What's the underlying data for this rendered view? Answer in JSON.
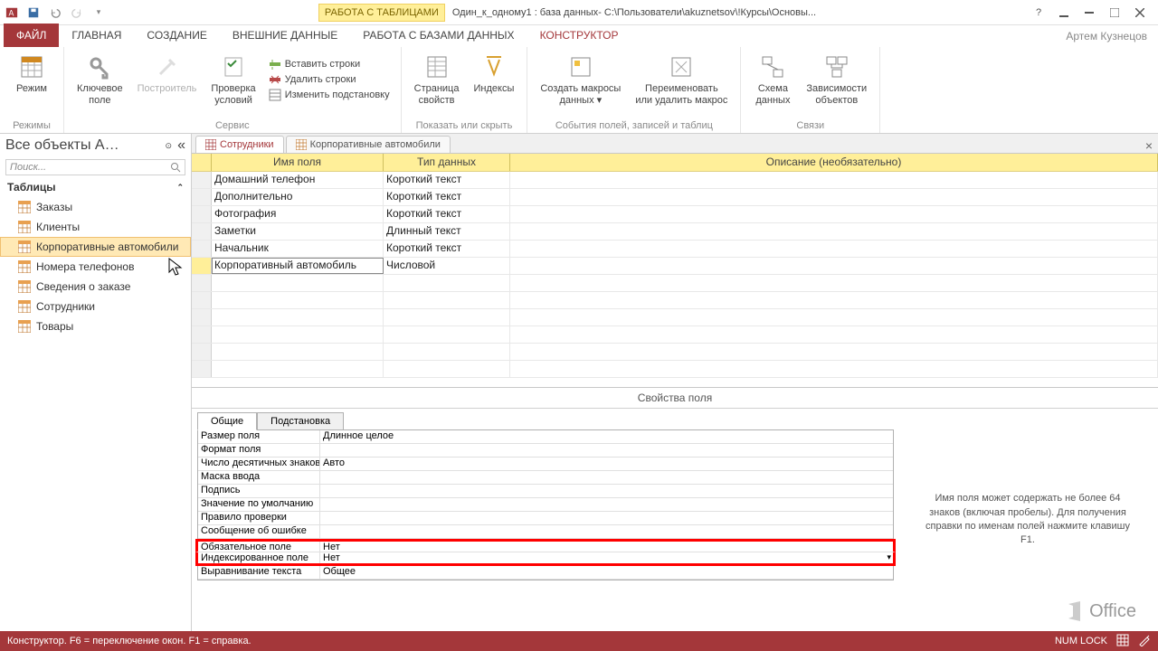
{
  "title": {
    "contextTab": "РАБОТА С ТАБЛИЦАМИ",
    "text": "Один_к_одному1 : база данных- C:\\Пользователи\\akuznetsov\\!Курсы\\Основы..."
  },
  "user": "Артем Кузнецов",
  "tabs": {
    "file": "ФАЙЛ",
    "home": "ГЛАВНАЯ",
    "create": "СОЗДАНИЕ",
    "external": "ВНЕШНИЕ ДАННЫЕ",
    "db": "РАБОТА С БАЗАМИ ДАННЫХ",
    "design": "КОНСТРУКТОР"
  },
  "ribbon": {
    "g1": {
      "label": "Режимы",
      "b1": "Режим"
    },
    "g2": {
      "label": "Сервис",
      "b1": "Ключевое\nполе",
      "b2": "Построитель",
      "b3": "Проверка\nусловий",
      "s1": "Вставить строки",
      "s2": "Удалить строки",
      "s3": "Изменить подстановку"
    },
    "g3": {
      "label": "Показать или скрыть",
      "b1": "Страница\nсвойств",
      "b2": "Индексы"
    },
    "g4": {
      "label": "События полей, записей и таблиц",
      "b1": "Создать макросы\nданных ▾",
      "b2": "Переименовать\nили удалить макрос"
    },
    "g5": {
      "label": "Связи",
      "b1": "Схема\nданных",
      "b2": "Зависимости\nобъектов"
    }
  },
  "nav": {
    "title": "Все объекты A…",
    "search": "Поиск...",
    "section": "Таблицы",
    "items": [
      "Заказы",
      "Клиенты",
      "Корпоративные автомобили",
      "Номера телефонов",
      "Сведения о заказе",
      "Сотрудники",
      "Товары"
    ]
  },
  "docTabs": {
    "t1": "Сотрудники",
    "t2": "Корпоративные автомобили"
  },
  "gridH": {
    "c1": "Имя поля",
    "c2": "Тип данных",
    "c3": "Описание (необязательно)"
  },
  "rows": [
    {
      "n": "Домашний телефон",
      "t": "Короткий текст"
    },
    {
      "n": "Дополнительно",
      "t": "Короткий текст"
    },
    {
      "n": "Фотография",
      "t": "Короткий текст"
    },
    {
      "n": "Заметки",
      "t": "Длинный текст"
    },
    {
      "n": "Начальник",
      "t": "Короткий текст"
    },
    {
      "n": "Корпоративный автомобиль",
      "t": "Числовой"
    }
  ],
  "propsHdr": "Свойства поля",
  "propTabs": {
    "t1": "Общие",
    "t2": "Подстановка"
  },
  "props": [
    {
      "l": "Размер поля",
      "v": "Длинное целое"
    },
    {
      "l": "Формат поля",
      "v": ""
    },
    {
      "l": "Число десятичных знаков",
      "v": "Авто"
    },
    {
      "l": "Маска ввода",
      "v": ""
    },
    {
      "l": "Подпись",
      "v": ""
    },
    {
      "l": "Значение по умолчанию",
      "v": ""
    },
    {
      "l": "Правило проверки",
      "v": ""
    },
    {
      "l": "Сообщение об ошибке",
      "v": ""
    },
    {
      "l": "Обязательное поле",
      "v": "Нет"
    },
    {
      "l": "Индексированное поле",
      "v": "Нет"
    },
    {
      "l": "Выравнивание текста",
      "v": "Общее"
    }
  ],
  "help": "Имя поля может содержать не более 64 знаков (включая пробелы). Для получения справки по именам полей нажмите клавишу F1.",
  "status": {
    "left": "Конструктор.   F6 = переключение окон.   F1 = справка.",
    "numlock": "NUM LOCK"
  },
  "office": "Office"
}
